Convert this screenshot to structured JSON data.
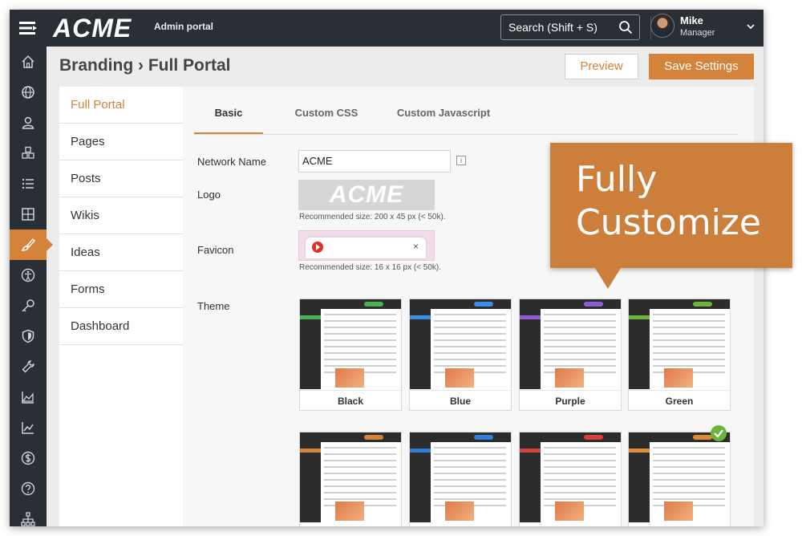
{
  "topbar": {
    "logo": "ACME",
    "portal_label": "Admin portal",
    "search_text": "Search (Shift + S)",
    "user": {
      "name": "Mike",
      "role": "Manager"
    }
  },
  "leftnav": {
    "icons": [
      "home-icon",
      "globe-icon",
      "user-icon",
      "cubes-icon",
      "list-icon",
      "grid-icon",
      "brush-icon",
      "accessibility-icon",
      "key-icon",
      "shield-icon",
      "wrench-icon",
      "area-chart-icon",
      "line-chart-icon",
      "dollar-icon",
      "help-icon",
      "sitemap-icon"
    ],
    "active": "brush-icon",
    "accent": "#d5823a"
  },
  "header": {
    "title": "Branding › Full Portal",
    "preview_label": "Preview",
    "save_label": "Save Settings"
  },
  "subnav": {
    "items": [
      {
        "label": "Full Portal"
      },
      {
        "label": "Pages"
      },
      {
        "label": "Posts"
      },
      {
        "label": "Wikis"
      },
      {
        "label": "Ideas"
      },
      {
        "label": "Forms"
      },
      {
        "label": "Dashboard"
      }
    ],
    "active": "Full Portal"
  },
  "tabs": [
    {
      "label": "Basic"
    },
    {
      "label": "Custom CSS"
    },
    {
      "label": "Custom Javascript"
    }
  ],
  "form": {
    "network_name_label": "Network Name",
    "network_name_value": "ACME",
    "info_glyph": "i",
    "logo_label": "Logo",
    "logo_text": "ACME",
    "logo_hint": "Recommended size: 200 x 45 px (< 50k).",
    "favicon_label": "Favicon",
    "favicon_close": "×",
    "favicon_hint": "Recommended size: 16 x 16 px (< 50k).",
    "theme_label": "Theme"
  },
  "themes": [
    {
      "label": "Black",
      "accent": "#4caf50"
    },
    {
      "label": "Blue",
      "accent": "#3a8ee6"
    },
    {
      "label": "Purple",
      "accent": "#8e5bd6"
    },
    {
      "label": "Green",
      "accent": "#6cb33e"
    },
    {
      "label": "",
      "accent": "#d5823a"
    },
    {
      "label": "",
      "accent": "#2f7fd8"
    },
    {
      "label": "",
      "accent": "#d94040"
    },
    {
      "label": "",
      "accent": "#e08a3a",
      "selected": true
    }
  ],
  "callout": {
    "line1": "Fully",
    "line2": "Customize"
  },
  "colors": {
    "accent": "#d5823a",
    "chrome": "#2a2e35",
    "callout": "#cc7f3a",
    "check": "#6cb33e"
  }
}
